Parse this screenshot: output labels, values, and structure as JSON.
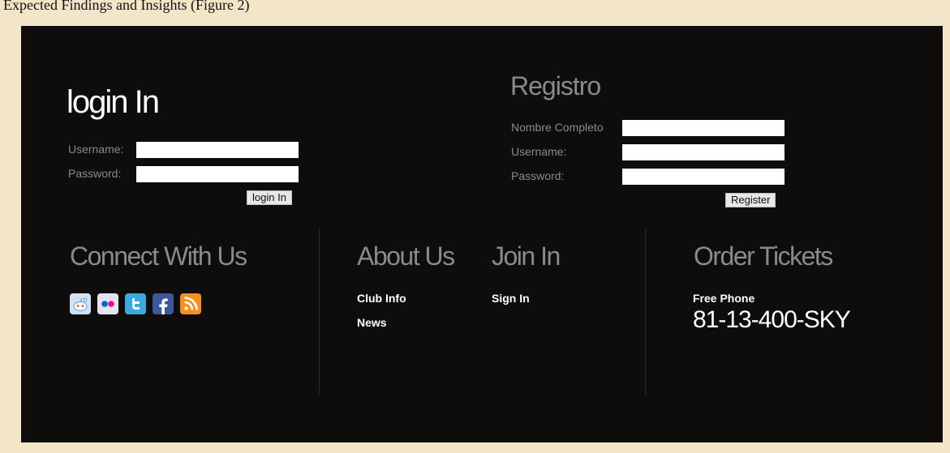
{
  "caption": "Expected Findings and Insights (Figure 2)",
  "login": {
    "title": "login In",
    "username_label": "Username:",
    "password_label": "Password:",
    "username_value": "",
    "password_value": "",
    "button_label": "login In"
  },
  "register": {
    "title": "Registro",
    "fullname_label": "Nombre Completo",
    "username_label": "Username:",
    "password_label": "Password:",
    "fullname_value": "",
    "username_value": "",
    "password_value": "",
    "button_label": "Register"
  },
  "connect": {
    "title": "Connect With Us",
    "icons": [
      "reddit-icon",
      "flickr-icon",
      "twitter-icon",
      "facebook-icon",
      "rss-icon"
    ]
  },
  "about": {
    "title": "About Us",
    "links": [
      "Club Info",
      "News"
    ]
  },
  "join": {
    "title": "Join In",
    "links": [
      "Sign In"
    ]
  },
  "tickets": {
    "title": "Order Tickets",
    "free_phone_label": "Free Phone",
    "phone_number": "81-13-400-SKY"
  },
  "colors": {
    "panel_bg": "#0e0d0c",
    "page_bg": "#f3e6c8",
    "heading_gray": "#8a8a8a",
    "text_white": "#ffffff"
  }
}
